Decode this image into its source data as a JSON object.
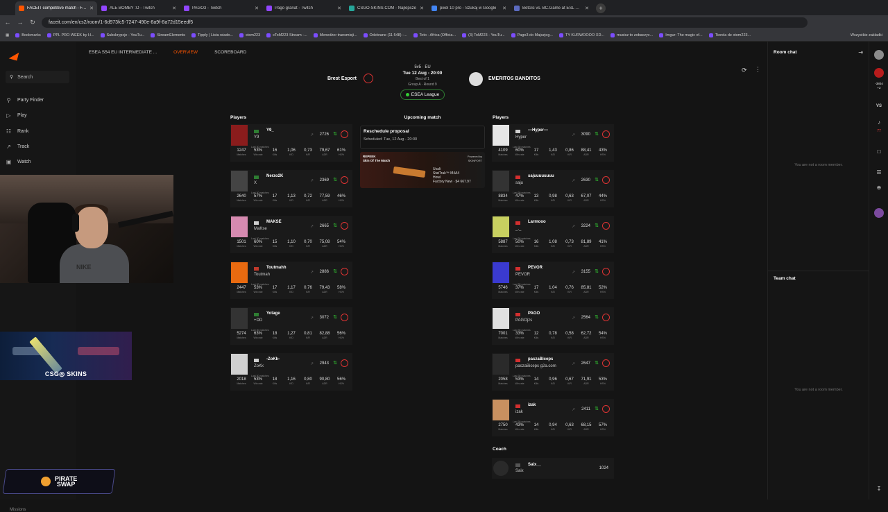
{
  "browser": {
    "tabs": [
      {
        "title": "FACEIT competitive match - FAC",
        "color": "#ff5500",
        "active": true
      },
      {
        "title": "ALE BOMBY :O - Twitch",
        "color": "#9146ff",
        "active": false
      },
      {
        "title": "PAGO3 - Twitch",
        "color": "#9146ff",
        "active": false
      },
      {
        "title": "Pago granat - Twitch",
        "color": "#9146ff",
        "active": false
      },
      {
        "title": "CSGO-SKINS.COM - Najlepsze",
        "color": "#26a69a",
        "active": false
      },
      {
        "title": "pixel 10 pro - Szukaj w Google",
        "color": "#4285f4",
        "active": false
      },
      {
        "title": "Betclic vs. BC.Game at ESL Chal",
        "color": "#5c6bc0",
        "active": false
      }
    ],
    "new_tab": "+",
    "url": "faceit.com/en/cs2/room/1-6d973fc5-7247-490e-8a9f-8a72d15eedf5",
    "bookmarks": [
      "Bookmarks",
      "PPL PRO WEEK by H...",
      "Subskrypcje - YouTu...",
      "StreamElements",
      "Tipply | Lista wiado...",
      "xtom223",
      "xToM223 Stream -...",
      "Menedżer transmisji...",
      "Odebrane (11 548) -...",
      "Toto - Africa (Officia...",
      "(3) ToM223 - YouTu...",
      "Pago3 do Majszjeg...",
      "TY KURWOOOO XD...",
      "musisz to zobaczyc...",
      "Imgur: The magic of...",
      "Tienda de xtom223..."
    ],
    "bookmarks_right": "Wszystkie zakładki"
  },
  "sidebar": {
    "search": "Search",
    "items": [
      {
        "label": "Party Finder",
        "icon": "party-icon"
      },
      {
        "label": "Play",
        "icon": "play-icon"
      },
      {
        "label": "Rank",
        "icon": "rank-icon"
      },
      {
        "label": "Track",
        "icon": "track-icon"
      },
      {
        "label": "Watch",
        "icon": "watch-icon"
      }
    ],
    "missions": "Missions"
  },
  "overlays": {
    "csgo_banner": "CSG◎ SKINS",
    "pirate_line1": "PIRATE",
    "pirate_line2": "SWAP",
    "webcam_shirt": "NIKE"
  },
  "topnav": {
    "title": "ESEA S54 EU INTERMEDIATE ...",
    "tabs": [
      "OVERVIEW",
      "SCOREBOARD"
    ]
  },
  "match": {
    "format": "5v5 · EU",
    "datetime": "Tue 12 Aug - 20:00",
    "best_of": "Best of 1",
    "group": "Group A · Round 9",
    "league": "ESEA League",
    "team_a": "Brest Esport",
    "team_b": "EMERITOS BANDITOS",
    "status": "Upcoming match"
  },
  "labels": {
    "players": "Players",
    "coach": "Coach",
    "last30": "Last 30 matches",
    "stat_labels": [
      "Matches",
      "Win rate",
      "Kills",
      "K/D",
      "K/R",
      "ADR",
      "HS%"
    ]
  },
  "reschedule": {
    "title": "Reschedule proposal",
    "scheduled": "Scheduled: Tue, 12 Aug - 20:00"
  },
  "skin_card": {
    "brand": "REPEEK",
    "title1": "Skin Of",
    "title2": "The Match",
    "powered": "Powered by",
    "sponsor": "SKINPORT",
    "item_by": "Usali",
    "item1": "StatTrak™ M4A4",
    "item2": "Howl",
    "item3": "Factory New · $4 667.97"
  },
  "team_a_players": [
    {
      "nick": "Y9_",
      "sub": "Y9",
      "elo": "2726",
      "stats": [
        "1247",
        "53%",
        "16",
        "1,06",
        "0,73",
        "79,67",
        "61%"
      ],
      "flag": "#2e7d32",
      "av": "#8a1c1c"
    },
    {
      "nick": "Nerzo2K",
      "sub": "X",
      "elo": "2369",
      "stats": [
        "2640",
        "57%",
        "17",
        "1,13",
        "0,72",
        "77,59",
        "46%"
      ],
      "flag": "#2e7d32",
      "av": "#444444"
    },
    {
      "nick": "MAKSE",
      "sub": "MaKse",
      "elo": "2665",
      "stats": [
        "1501",
        "60%",
        "15",
        "1,10",
        "0,70",
        "75,08",
        "54%"
      ],
      "flag": "#cfcfcf",
      "av": "#d68ab0"
    },
    {
      "nick": "Toutmahh",
      "sub": "Toutmah",
      "elo": "2886",
      "stats": [
        "2447",
        "53%",
        "17",
        "1,17",
        "0,76",
        "79,43",
        "58%"
      ],
      "flag": "#c0392b",
      "av": "#e86a10"
    },
    {
      "nick": "Yotage",
      "sub": "+DD",
      "elo": "3072",
      "stats": [
        "5274",
        "63%",
        "18",
        "1,27",
        "0,81",
        "82,88",
        "56%"
      ],
      "flag": "#2e7d32",
      "av": "#333333"
    },
    {
      "nick": "-ZoKk-",
      "sub": "ZoKk",
      "elo": "2943",
      "stats": [
        "2018",
        "53%",
        "18",
        "1,16",
        "0,80",
        "90,80",
        "56%"
      ],
      "flag": "#cfcfcf",
      "av": "#d0d0d0"
    }
  ],
  "team_b_players": [
    {
      "nick": "---Hyper---",
      "sub": "Hyper",
      "elo": "3090",
      "stats": [
        "4109",
        "60%",
        "17",
        "1,43",
        "0,86",
        "88,41",
        "43%"
      ],
      "flag": "#cfcfcf",
      "av": "#e6e6e6"
    },
    {
      "nick": "sajuuuuuuuu",
      "sub": "saju",
      "elo": "2630",
      "stats": [
        "8834",
        "47%",
        "13",
        "0,98",
        "0,63",
        "67,07",
        "44%"
      ],
      "flag": "#d32f2f",
      "av": "#333333"
    },
    {
      "nick": "Larmooo",
      "sub": "_._",
      "elo": "3224",
      "stats": [
        "5887",
        "50%",
        "16",
        "1,08",
        "0,73",
        "81,89",
        "41%"
      ],
      "flag": "#d32f2f",
      "av": "#c8d060"
    },
    {
      "nick": "PEVOR",
      "sub": "PEVOR",
      "elo": "3155",
      "stats": [
        "5746",
        "37%",
        "17",
        "1,04",
        "0,76",
        "85,81",
        "52%"
      ],
      "flag": "#d32f2f",
      "av": "#3a3ad0"
    },
    {
      "nick": "PAGO",
      "sub": "PAGOjzs",
      "elo": "2564",
      "stats": [
        "7001",
        "33%",
        "12",
        "0,78",
        "0,58",
        "62,72",
        "54%"
      ],
      "flag": "#d32f2f",
      "av": "#e0e0e0"
    },
    {
      "nick": "paszaBiceps",
      "sub": "paszaBiceps g2a.com",
      "elo": "2647",
      "stats": [
        "2058",
        "53%",
        "14",
        "0,96",
        "0,67",
        "71,91",
        "53%"
      ],
      "flag": "#d32f2f",
      "av": "#2a2a2a"
    },
    {
      "nick": "izak",
      "sub": "izak",
      "elo": "2411",
      "stats": [
        "2750",
        "43%",
        "14",
        "0,94",
        "0,63",
        "68,15",
        "57%"
      ],
      "flag": "#d32f2f",
      "av": "#c89060"
    }
  ],
  "coach": {
    "nick": "Saix__",
    "sub": "Saix",
    "elo": "1024"
  },
  "room_chat": {
    "title": "Room chat",
    "empty": "You are not a room member.",
    "team_title": "Team chat",
    "team_empty": "You are not a room member."
  },
  "rail": {
    "points": "-3804",
    "points_sub": "+2",
    "vs": "VS",
    "badge": "77"
  }
}
